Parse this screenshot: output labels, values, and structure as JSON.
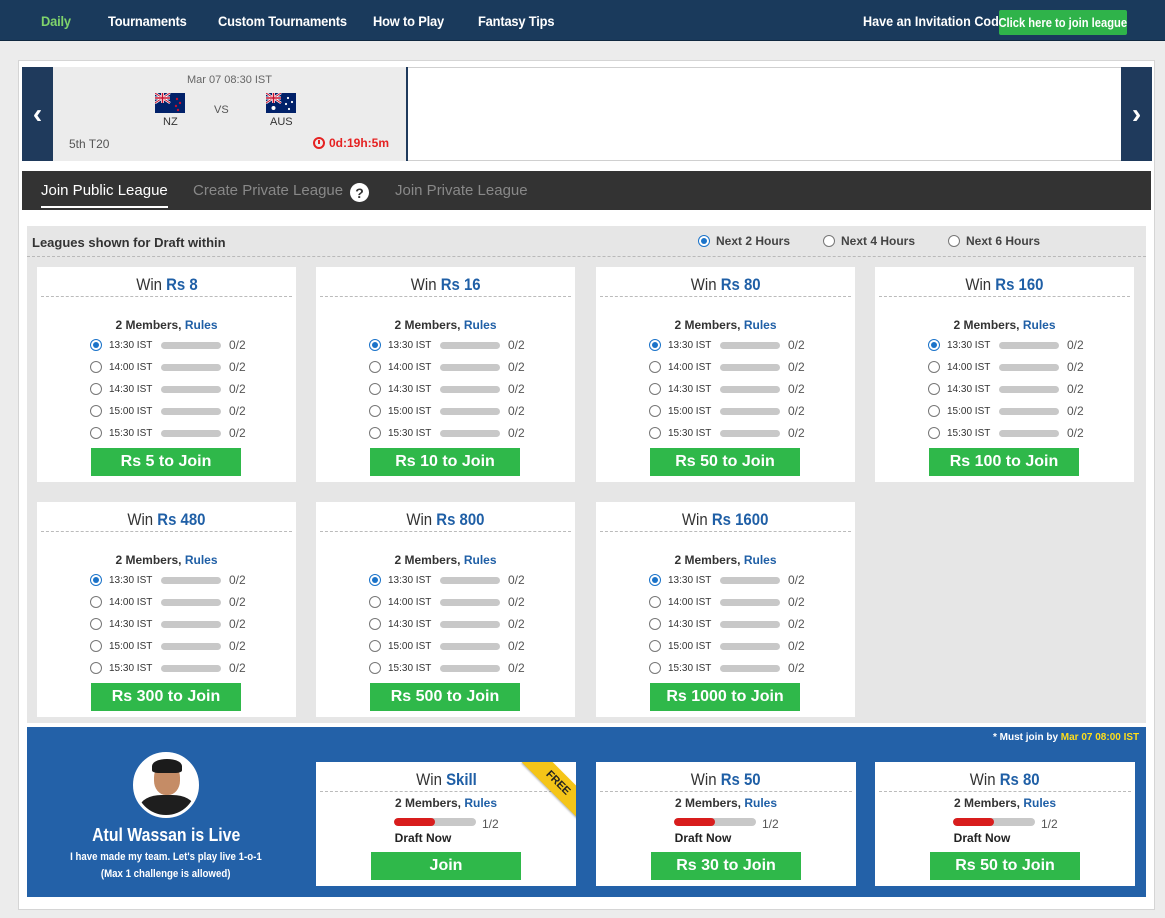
{
  "nav": {
    "items": [
      "Daily",
      "Tournaments",
      "Custom Tournaments",
      "How to Play",
      "Fantasy Tips"
    ],
    "invite_label": "Have an Invitation Code?",
    "join_league_label": "Click here to join league"
  },
  "match": {
    "date": "Mar 07 08:30 IST",
    "team1": "NZ",
    "team2": "AUS",
    "vs": "VS",
    "type": "5th T20",
    "countdown": "0d:19h:5m",
    "prev_arrow": "‹",
    "next_arrow": "›"
  },
  "tabs": [
    "Join Public League",
    "Create Private League",
    "Join Private League"
  ],
  "help_icon": "?",
  "filters": {
    "title": "Leagues shown for Draft within",
    "options": [
      "Next 2 Hours",
      "Next 4 Hours",
      "Next 6 Hours"
    ],
    "selected": 0
  },
  "slot_times": [
    "13:30 IST",
    "14:00 IST",
    "14:30 IST",
    "15:00 IST",
    "15:30 IST"
  ],
  "leagues": [
    {
      "win_prefix": "Win",
      "win": "Rs 8",
      "members": "2 Members,",
      "rules": "Rules",
      "count": "0/2",
      "join": "Rs 5 to Join"
    },
    {
      "win_prefix": "Win",
      "win": "Rs 16",
      "members": "2 Members,",
      "rules": "Rules",
      "count": "0/2",
      "join": "Rs 10 to Join"
    },
    {
      "win_prefix": "Win",
      "win": "Rs 80",
      "members": "2 Members,",
      "rules": "Rules",
      "count": "0/2",
      "join": "Rs 50 to Join"
    },
    {
      "win_prefix": "Win",
      "win": "Rs 160",
      "members": "2 Members,",
      "rules": "Rules",
      "count": "0/2",
      "join": "Rs 100 to Join"
    },
    {
      "win_prefix": "Win",
      "win": "Rs 480",
      "members": "2 Members,",
      "rules": "Rules",
      "count": "0/2",
      "join": "Rs 300 to Join"
    },
    {
      "win_prefix": "Win",
      "win": "Rs 800",
      "members": "2 Members,",
      "rules": "Rules",
      "count": "0/2",
      "join": "Rs 500 to Join"
    },
    {
      "win_prefix": "Win",
      "win": "Rs 1600",
      "members": "2 Members,",
      "rules": "Rules",
      "count": "0/2",
      "join": "Rs 1000 to Join"
    }
  ],
  "live": {
    "note_prefix": "* Must join by",
    "note_time": "Mar 07 08:00 IST",
    "name": "Atul Wassan is Live",
    "line1": "I have made my team. Let's play live 1-o-1",
    "line2": "(Max 1 challenge is allowed)",
    "cards": [
      {
        "win_prefix": "Win",
        "win": "Skill",
        "members": "2 Members,",
        "rules": "Rules",
        "count": "1/2",
        "progress": 0.5,
        "draft": "Draft Now",
        "join": "Join",
        "ribbon": "FREE"
      },
      {
        "win_prefix": "Win",
        "win": "Rs 50",
        "members": "2 Members,",
        "rules": "Rules",
        "count": "1/2",
        "progress": 0.5,
        "draft": "Draft Now",
        "join": "Rs 30 to Join"
      },
      {
        "win_prefix": "Win",
        "win": "Rs 80",
        "members": "2 Members,",
        "rules": "Rules",
        "count": "1/2",
        "progress": 0.5,
        "draft": "Draft Now",
        "join": "Rs 50 to Join"
      }
    ]
  },
  "colors": {
    "nav_bg": "#1a3a5c",
    "accent_green": "#2fb84a",
    "link_blue": "#1f5fa6",
    "live_bg": "#2361a8",
    "countdown_red": "#e52222"
  }
}
